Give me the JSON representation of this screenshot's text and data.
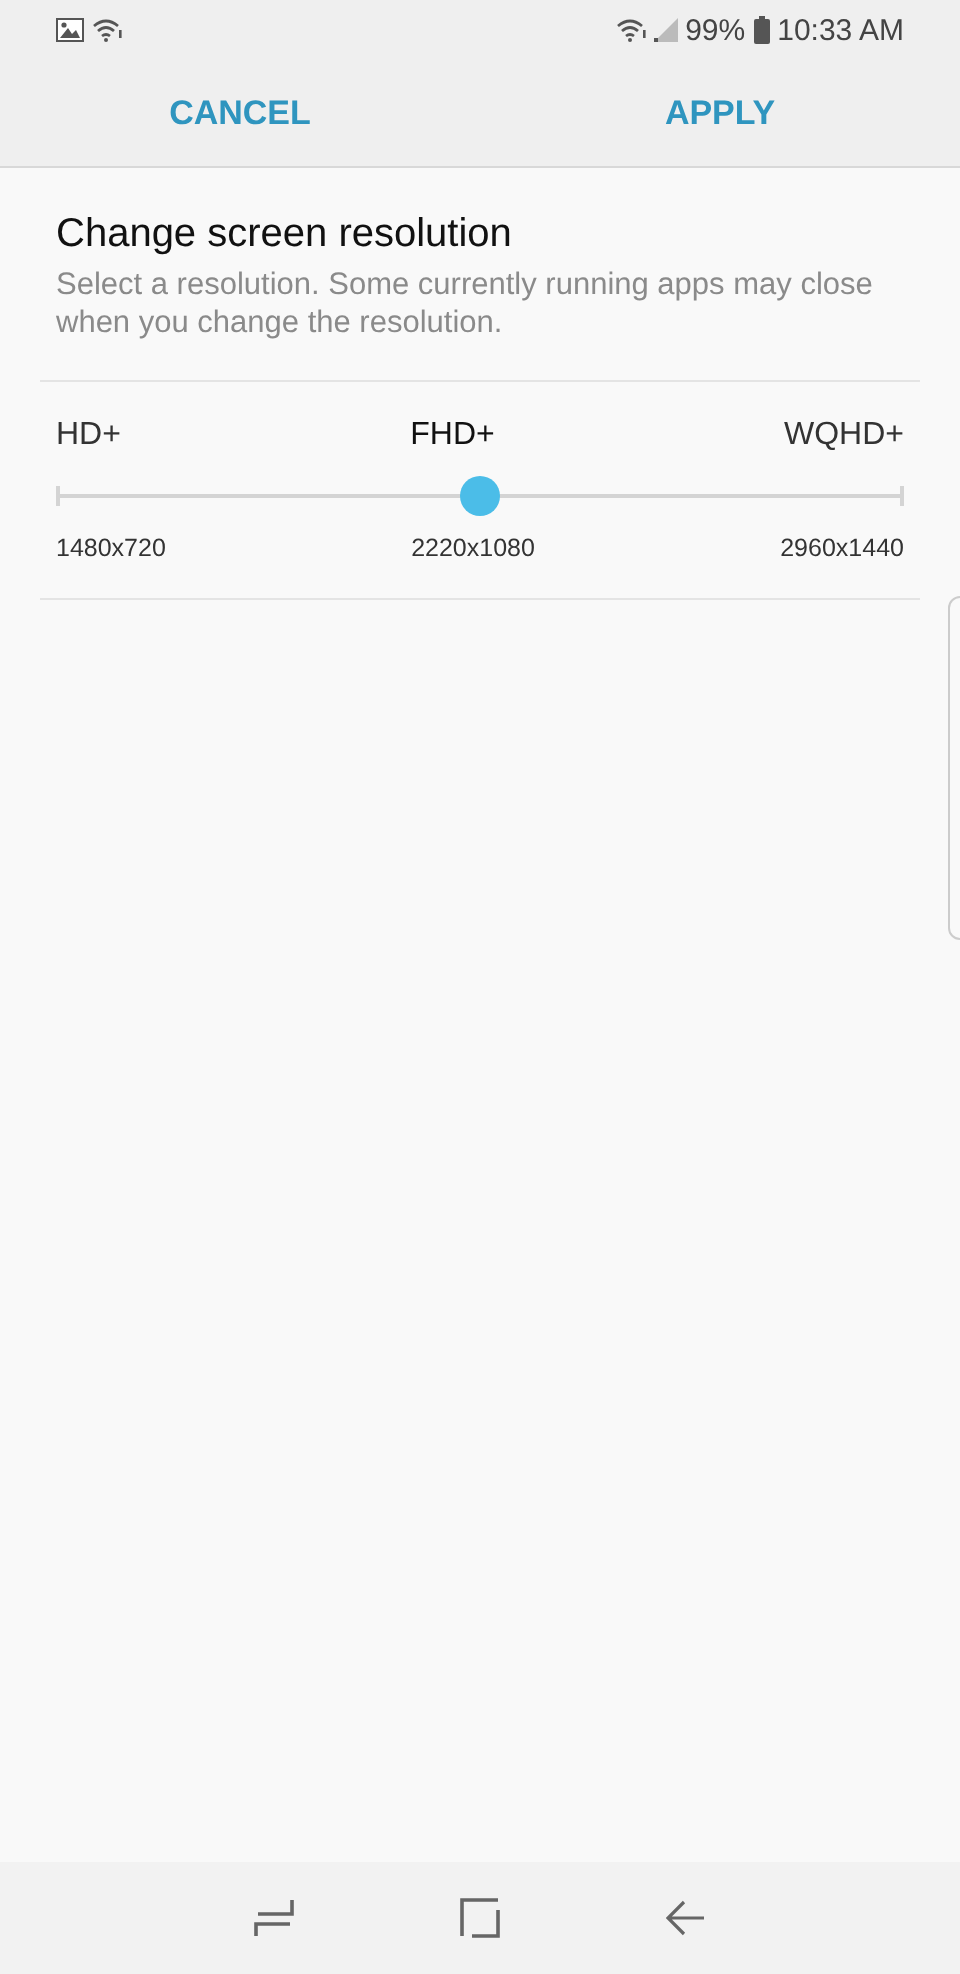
{
  "status_bar": {
    "battery": "99%",
    "time": "10:33 AM"
  },
  "action_bar": {
    "buttons": [
      "CANCEL",
      "APPLY"
    ]
  },
  "title": "Change screen resolution",
  "description": "Select a resolution. Some currently running apps may close when you change the resolution.",
  "slider": {
    "level": 0.5,
    "options": [
      {
        "label": "HD+",
        "resolution": "1480x720",
        "selected": false
      },
      {
        "label": "FHD+",
        "resolution": "2220x1080",
        "selected": true
      },
      {
        "label": "WQHD+",
        "resolution": "2960x1440",
        "selected": false
      }
    ]
  }
}
